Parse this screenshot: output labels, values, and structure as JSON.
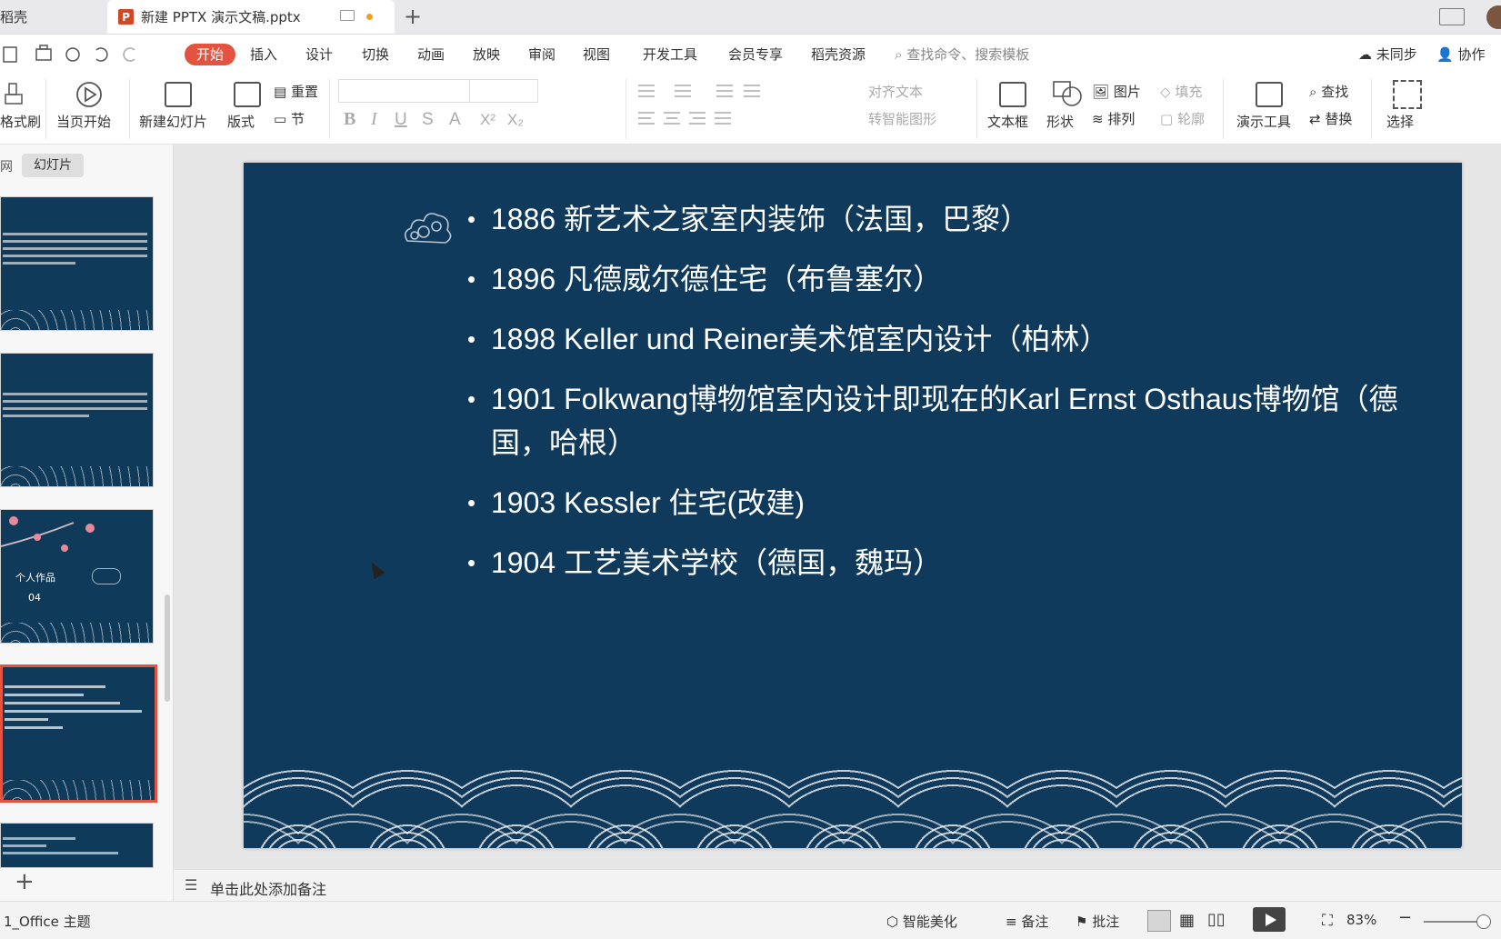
{
  "tabs": {
    "home_label": "稻壳",
    "doc_label": "新建 PPTX 演示文稿.pptx",
    "doc_icon": "P",
    "add": "+"
  },
  "menu": {
    "items": [
      "开始",
      "插入",
      "设计",
      "切换",
      "动画",
      "放映",
      "审阅",
      "视图",
      "开发工具",
      "会员专享",
      "稻壳资源"
    ],
    "search_placeholder": "查找命令、搜索模板",
    "sync": "未同步",
    "collab": "协作"
  },
  "ribbon": {
    "format_painter": "格式刷",
    "play_from_current": "当页开始",
    "new_slide": "新建幻灯片",
    "layout": "版式",
    "reset": "重置",
    "section": "节",
    "align_text": "对齐文本",
    "smart_shape": "转智能图形",
    "textbox": "文本框",
    "shape": "形状",
    "picture": "图片",
    "arrange": "排列",
    "fill": "填充",
    "outline": "轮廓",
    "present_tools": "演示工具",
    "find": "查找",
    "replace": "替换",
    "select": "选择"
  },
  "left_panel": {
    "outline_tab": "网",
    "slides_tab": "幻灯片",
    "thumb3_title": "个人作品",
    "thumb3_number": "04",
    "add": "+"
  },
  "slide": {
    "bullets": [
      "1886 新艺术之家室内装饰（法国，巴黎）",
      "1896 凡德威尔德住宅（布鲁塞尔）",
      "1898 Keller und Reiner美术馆室内设计（柏林）",
      "1901 Folkwang博物馆室内设计即现在的Karl Ernst Osthaus博物馆（德国，哈根）",
      "1903 Kessler 住宅(改建)",
      "1904 工艺美术学校（德国，魏玛）"
    ],
    "background_color": "#103a5b"
  },
  "notes": {
    "placeholder": "单击此处添加备注"
  },
  "status": {
    "theme": "1_Office 主题",
    "beautify": "智能美化",
    "notes": "备注",
    "comments": "批注",
    "zoom": "83%"
  },
  "colors": {
    "accent": "#e3533f",
    "slide_bg": "#103a5b"
  }
}
